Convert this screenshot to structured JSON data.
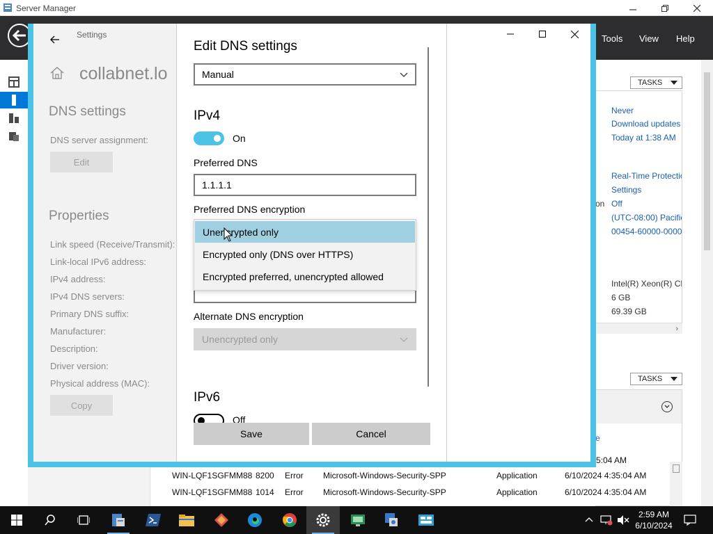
{
  "server_manager": {
    "title": "Server Manager",
    "menu": {
      "tools": "Tools",
      "view": "View",
      "help": "Help"
    },
    "tasks_label": "TASKS",
    "properties_panel": {
      "last_checked": "Never",
      "windows_update": "Download updates",
      "last_update": "Today at 1:38 AM",
      "defender": "Real-Time Protectio",
      "feedback": "Settings",
      "ie_esc_prefix": "on",
      "ie_esc": "Off",
      "timezone": "(UTC-08:00) Pacific",
      "product_id": "00454-60000-0000",
      "processor": "Intel(R) Xeon(R) CP",
      "memory": "6 GB",
      "disk": "69.39 GB"
    },
    "events_panel": {
      "partial_label": "e"
    },
    "events": [
      {
        "server": "",
        "id": "",
        "severity": "",
        "source": "",
        "log": "",
        "date": "5:04 AM"
      },
      {
        "server": "WIN-LQF1SGFMM88",
        "id": "8200",
        "severity": "Error",
        "source": "Microsoft-Windows-Security-SPP",
        "log": "Application",
        "date": "6/10/2024 4:35:04 AM"
      },
      {
        "server": "WIN-LQF1SGFMM88",
        "id": "1014",
        "severity": "Error",
        "source": "Microsoft-Windows-Security-SPP",
        "log": "Application",
        "date": "6/10/2024 4:35:04 AM"
      }
    ]
  },
  "settings": {
    "back_label": "Settings",
    "adapter_name": "collabnet.lo",
    "section_title": "DNS settings",
    "dns_assignment_label": "DNS server assignment:",
    "edit_button": "Edit",
    "properties_title": "Properties",
    "properties": [
      "Link speed (Receive/Transmit):",
      "Link-local IPv6 address:",
      "IPv4 address:",
      "IPv4 DNS servers:",
      "Primary DNS suffix:",
      "Manufacturer:",
      "Description:",
      "Driver version:",
      "Physical address (MAC):"
    ],
    "copy_button": "Copy"
  },
  "dialog": {
    "title": "Edit DNS settings",
    "mode_value": "Manual",
    "ipv4": {
      "heading": "IPv4",
      "toggle_state": "On",
      "preferred_dns_label": "Preferred DNS",
      "preferred_dns_value": "1.1.1.1",
      "preferred_encryption_label": "Preferred DNS encryption",
      "encryption_options": [
        "Unencrypted only",
        "Encrypted only (DNS over HTTPS)",
        "Encrypted preferred, unencrypted allowed"
      ],
      "encryption_selected_index": 0,
      "alternate_encryption_label": "Alternate DNS encryption",
      "alternate_encryption_value": "Unencrypted only"
    },
    "ipv6": {
      "heading": "IPv6",
      "toggle_state": "Off"
    },
    "save_button": "Save",
    "cancel_button": "Cancel"
  },
  "taskbar": {
    "time": "2:59 AM",
    "date": "6/10/2024"
  },
  "colors": {
    "accent": "#4cc2e6",
    "selected_option": "#9fd0e2",
    "link": "#1a5fb4",
    "header": "#2d2d30",
    "taskbar": "#101010"
  }
}
